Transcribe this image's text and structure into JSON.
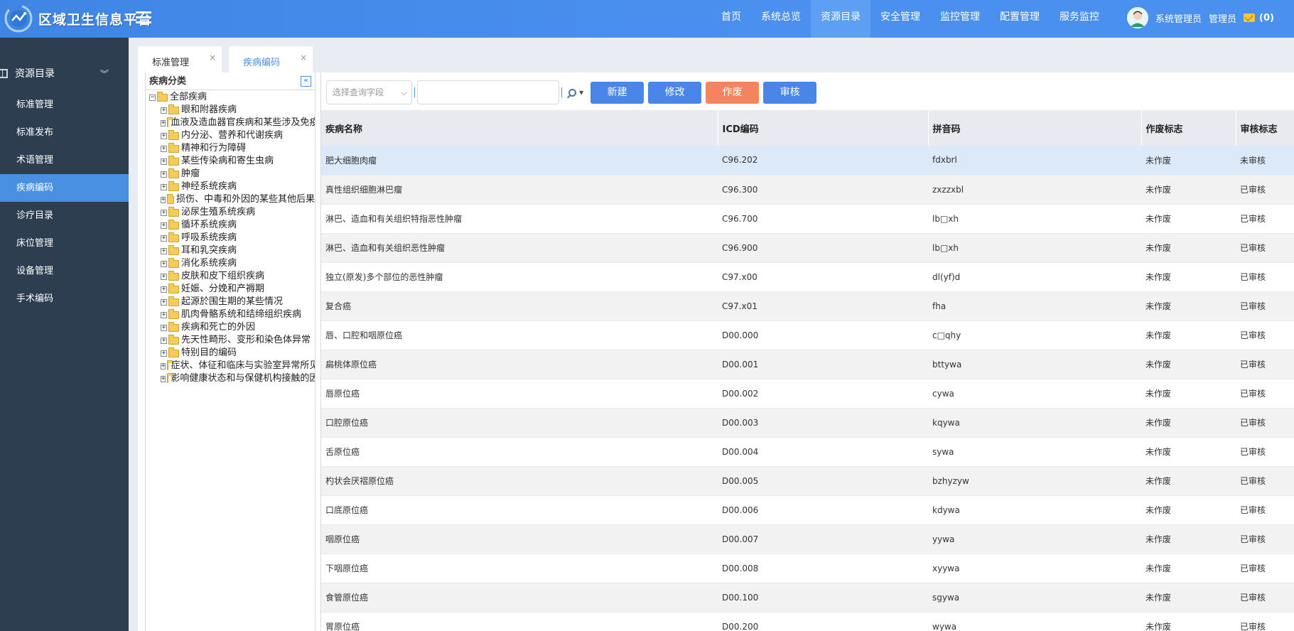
{
  "app": {
    "title": "区域卫生信息平台"
  },
  "topnav": {
    "items": [
      "首页",
      "系统总览",
      "资源目录",
      "安全管理",
      "监控管理",
      "配置管理",
      "服务监控"
    ],
    "active_index": 2
  },
  "user": {
    "name": "系统管理员",
    "role": "管理员",
    "mail_count": "(0)"
  },
  "sidebar": {
    "header": "资源目录",
    "items": [
      "标准管理",
      "标准发布",
      "术语管理",
      "疾病编码",
      "诊疗目录",
      "床位管理",
      "设备管理",
      "手术编码"
    ],
    "active_index": 3
  },
  "tabs": [
    {
      "label": "标准管理",
      "close": "×",
      "active": false
    },
    {
      "label": "疾病编码",
      "close": "×",
      "active": true
    }
  ],
  "tree": {
    "title": "疾病分类",
    "collapse_icon": "«",
    "root": "全部疾病",
    "nodes": [
      "眼和附器疾病",
      "血液及造血器官疾病和某些涉及免疫机制的疾患",
      "内分泌、营养和代谢疾病",
      "精神和行为障碍",
      "某些传染病和寄生虫病",
      "肿瘤",
      "神经系统疾病",
      "损伤、中毒和外因的某些其他后果",
      "泌尿生殖系统疾病",
      "循环系统疾病",
      "呼吸系统疾病",
      "耳和乳突疾病",
      "消化系统疾病",
      "皮肤和皮下组织疾病",
      "妊娠、分娩和产褥期",
      "起源於围生期的某些情况",
      "肌肉骨骼系统和结缔组织疾病",
      "疾病和死亡的外因",
      "先天性畸形、变形和染色体异常",
      "特别目的编码",
      "症状、体征和临床与实验室异常所见",
      "影响健康状态和与保健机构接触的因素"
    ]
  },
  "toolbar": {
    "select_placeholder": "选择查询字段",
    "search_value": "",
    "buttons": {
      "new": "新建",
      "edit": "修改",
      "void": "作废",
      "review": "审核"
    }
  },
  "table": {
    "headers": [
      "疾病名称",
      "ICD编码",
      "拼音码",
      "作废标志",
      "审核标志"
    ],
    "rows": [
      [
        "肥大细胞肉瘤",
        "C96.202",
        "fdxbrl",
        "未作废",
        "未审核"
      ],
      [
        "真性组织细胞淋巴瘤",
        "C96.300",
        "zxzzxbl",
        "未作废",
        "已审核"
      ],
      [
        "淋巴、造血和有关组织特指恶性肿瘤",
        "C96.700",
        "lb□xh",
        "未作废",
        "已审核"
      ],
      [
        "淋巴、造血和有关组织恶性肿瘤",
        "C96.900",
        "lb□xh",
        "未作废",
        "已审核"
      ],
      [
        "独立(原发)多个部位的恶性肿瘤",
        "C97.x00",
        "dl(yf)d",
        "未作废",
        "已审核"
      ],
      [
        "复合癌",
        "C97.x01",
        "fha",
        "未作废",
        "已审核"
      ],
      [
        "唇、口腔和咽原位癌",
        "D00.000",
        "c□qhy",
        "未作废",
        "已审核"
      ],
      [
        "扁桃体原位癌",
        "D00.001",
        "bttywa",
        "未作废",
        "已审核"
      ],
      [
        "唇原位癌",
        "D00.002",
        "cywa",
        "未作废",
        "已审核"
      ],
      [
        "口腔原位癌",
        "D00.003",
        "kqywa",
        "未作废",
        "已审核"
      ],
      [
        "舌原位癌",
        "D00.004",
        "sywa",
        "未作废",
        "已审核"
      ],
      [
        "杓状会厌褶原位癌",
        "D00.005",
        "bzhyzyw",
        "未作废",
        "已审核"
      ],
      [
        "口底原位癌",
        "D00.006",
        "kdywa",
        "未作废",
        "已审核"
      ],
      [
        "咽原位癌",
        "D00.007",
        "yywa",
        "未作废",
        "已审核"
      ],
      [
        "下咽原位癌",
        "D00.008",
        "xyywa",
        "未作废",
        "已审核"
      ],
      [
        "食管原位癌",
        "D00.100",
        "sgywa",
        "未作废",
        "已审核"
      ],
      [
        "胃原位癌",
        "D00.200",
        "wywa",
        "未作废",
        "已审核"
      ]
    ]
  }
}
